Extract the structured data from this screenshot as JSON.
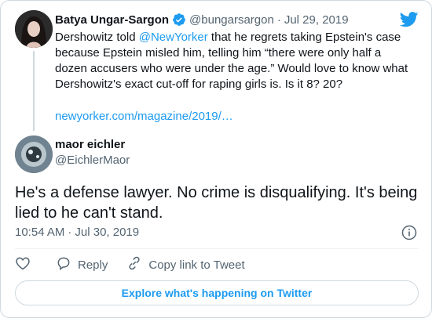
{
  "quoted": {
    "author_name": "Batya Ungar-Sargon",
    "author_handle": "@bungarsargon",
    "separator": "·",
    "date": "Jul 29, 2019",
    "text_before": "Dershowitz told ",
    "mention": "@NewYorker",
    "text_after": " that he regrets taking Epstein's case because Epstein misled him, telling him “there were only half a dozen accusers who were under the age.” Would love to know what Dershowitz's exact cut-off for raping girls is. Is it 8? 20?",
    "link": "newyorker.com/magazine/2019/…"
  },
  "tweet": {
    "author_name": "maor eichler",
    "author_handle": "@EichlerMaor",
    "text": "He's a defense lawyer. No crime is disqualifying. It's being lied to he can't stand.",
    "time": "10:54 AM",
    "separator": "·",
    "date": "Jul 30, 2019"
  },
  "actions": {
    "reply_label": "Reply",
    "copy_link_label": "Copy link to Tweet"
  },
  "explore_label": "Explore what's happening on Twitter",
  "colors": {
    "accent": "#1d9bf0",
    "text": "#0f1419",
    "secondary": "#536471",
    "border": "#cfd9de"
  },
  "icons": [
    "verified-badge-icon",
    "twitter-bird-icon",
    "info-icon",
    "heart-icon",
    "reply-icon",
    "link-icon"
  ]
}
